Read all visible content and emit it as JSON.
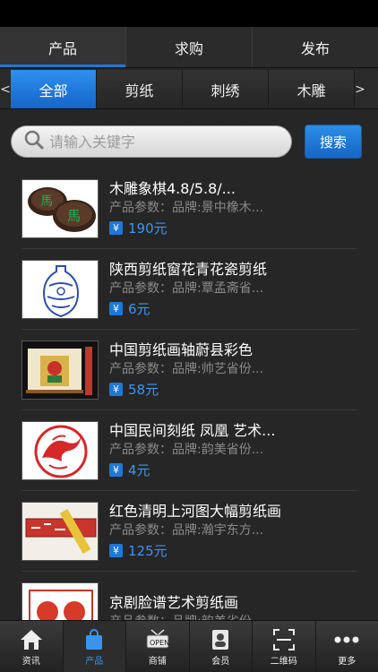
{
  "main_tabs": [
    "产品",
    "求购",
    "发布"
  ],
  "categories": {
    "left_arrow": "<",
    "right_arrow": ">",
    "items": [
      "全部",
      "剪纸",
      "刺绣",
      "木雕"
    ]
  },
  "search": {
    "placeholder": "请输入关键字",
    "button": "搜索"
  },
  "currency_symbol": "¥",
  "products": [
    {
      "title": "木雕象棋4.8/5.8/...",
      "params": "产品参数：品牌:景中橡木...",
      "price": "190元"
    },
    {
      "title": "陕西剪纸窗花青花瓷剪纸",
      "params": "产品参数：品牌:覃孟斋省...",
      "price": "6元"
    },
    {
      "title": "中国剪纸画轴蔚县彩色",
      "params": "产品参数：品牌:帅艺省份...",
      "price": "58元"
    },
    {
      "title": "中国民间刻纸 凤凰 艺术...",
      "params": "产品参数：品牌:韵美省份...",
      "price": "4元"
    },
    {
      "title": "红色清明上河图大幅剪纸画",
      "params": "产品参数：品牌:瀚宇东方...",
      "price": "125元"
    },
    {
      "title": "京剧脸谱艺术剪纸画",
      "params": "产品参数：品牌:韵美省份...",
      "price": ""
    }
  ],
  "bottom_nav": [
    "资讯",
    "产品",
    "商铺",
    "会员",
    "二维码",
    "更多"
  ],
  "shop_sign_text": "OPEN",
  "colors": {
    "accent": "#1e78d8",
    "price": "#3d95f0"
  }
}
